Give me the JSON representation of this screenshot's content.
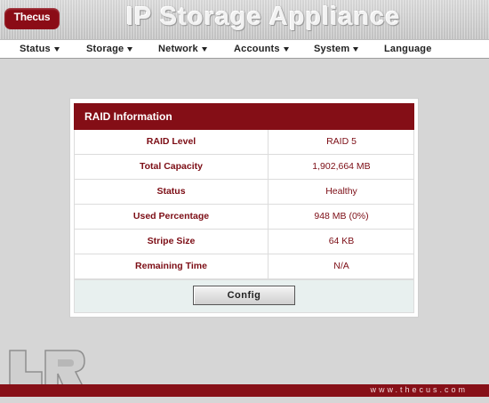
{
  "header": {
    "logo_text": "Thecus",
    "title": "IP Storage Appliance"
  },
  "nav": {
    "items": [
      {
        "label": "Status",
        "has_menu": true
      },
      {
        "label": "Storage",
        "has_menu": true
      },
      {
        "label": "Network",
        "has_menu": true
      },
      {
        "label": "Accounts",
        "has_menu": true
      },
      {
        "label": "System",
        "has_menu": true
      },
      {
        "label": "Language",
        "has_menu": false
      }
    ]
  },
  "panel": {
    "title": "RAID Information",
    "rows": [
      {
        "label": "RAID Level",
        "value": "RAID 5"
      },
      {
        "label": "Total Capacity",
        "value": "1,902,664 MB"
      },
      {
        "label": "Status",
        "value": "Healthy"
      },
      {
        "label": "Used Percentage",
        "value": "948 MB (0%)"
      },
      {
        "label": "Stripe Size",
        "value": "64 KB"
      },
      {
        "label": "Remaining Time",
        "value": "N/A"
      }
    ],
    "config_label": "Config"
  },
  "footer": {
    "url": "www.thecus.com"
  },
  "colors": {
    "brand": "#840e16",
    "background": "#d6d6d6",
    "panel_footer": "#e8f0ef"
  }
}
